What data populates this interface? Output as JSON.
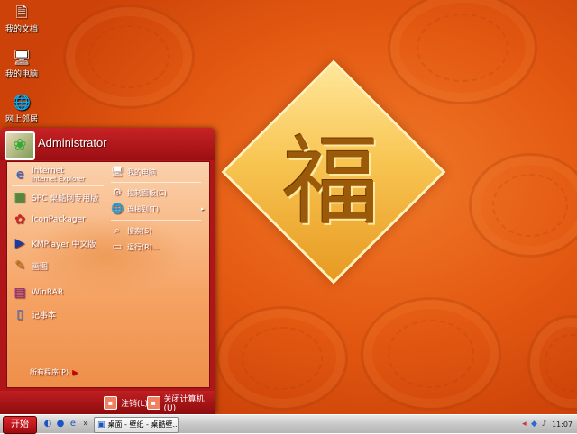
{
  "desktop": {
    "icons": [
      {
        "label": "我的文档",
        "icon": "folder-documents-icon",
        "glyph": "🗎"
      },
      {
        "label": "我的电脑",
        "icon": "computer-icon",
        "glyph": "🖥"
      },
      {
        "label": "网上邻居",
        "icon": "network-icon",
        "glyph": "🌐"
      }
    ],
    "wallpaper_character": "福",
    "colors": {
      "background": "#e45a12",
      "diamond": "#f8c552"
    }
  },
  "start_menu": {
    "user": "Administrator",
    "left_items": [
      {
        "label": "Internet",
        "sublabel": "Internet Explorer",
        "icon": "internet-explorer-icon",
        "glyph": "e"
      },
      {
        "label": "SPC 桌酷网专用版",
        "icon": "spc-app-icon",
        "glyph": "▦"
      },
      {
        "label": "IconPackager",
        "icon": "iconpackager-icon",
        "glyph": "✿"
      },
      {
        "label": "KMPlayer 中文版",
        "icon": "kmplayer-icon",
        "glyph": "▶"
      },
      {
        "label": "画图",
        "icon": "paint-icon",
        "glyph": "✎"
      },
      {
        "label": "WinRAR",
        "icon": "winrar-icon",
        "glyph": "▤"
      },
      {
        "label": "记事本",
        "icon": "notepad-icon",
        "glyph": "▯"
      }
    ],
    "right_items": [
      {
        "label": "我的电脑",
        "icon": "my-computer-icon",
        "glyph": "🖥"
      },
      {
        "label": "控制面板(C)",
        "icon": "control-panel-icon",
        "glyph": "⚙"
      },
      {
        "label": "连接到(T)",
        "icon": "connect-to-icon",
        "glyph": "🌐"
      },
      {
        "label": "搜索(S)",
        "icon": "search-icon",
        "glyph": "⌕"
      },
      {
        "label": "运行(R)...",
        "icon": "run-icon",
        "glyph": "▭"
      }
    ],
    "all_programs": "所有程序(P)",
    "footer": {
      "logoff": "注销(L)",
      "shutdown": "关闭计算机(U)"
    }
  },
  "taskbar": {
    "start_label": "开始",
    "quick_launch": [
      {
        "icon": "show-desktop-icon",
        "glyph": "◐"
      },
      {
        "icon": "media-player-icon",
        "glyph": "●"
      },
      {
        "icon": "ie-quick-icon",
        "glyph": "e"
      },
      {
        "icon": "quick-launch-overflow-icon",
        "glyph": "»"
      }
    ],
    "task_item": "桌面 - 壁纸 - 桌酷壁...",
    "tray_icons": [
      {
        "icon": "tray-back-icon",
        "glyph": "◂"
      },
      {
        "icon": "tray-app-icon",
        "glyph": "◆"
      },
      {
        "icon": "tray-volume-icon",
        "glyph": "♪"
      }
    ],
    "clock": "11:07",
    "colors": {
      "start": "#c41a1e",
      "bar": "#c8c8c8"
    }
  }
}
